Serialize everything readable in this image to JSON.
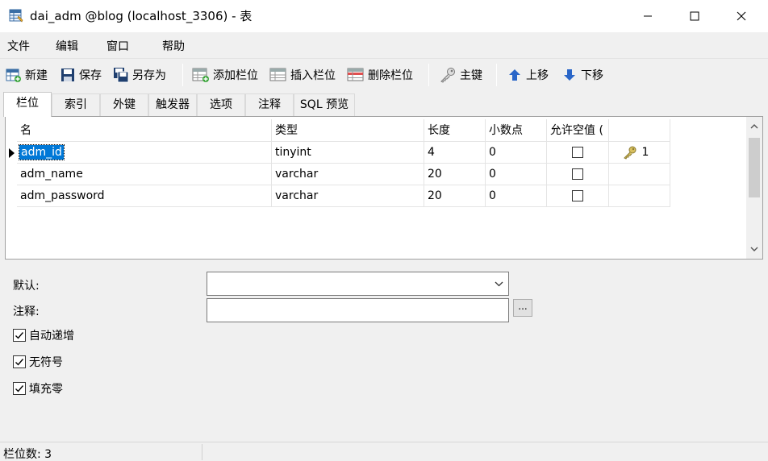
{
  "window": {
    "title": "dai_adm @blog (localhost_3306) - 表"
  },
  "menu": [
    "文件",
    "编辑",
    "窗口",
    "帮助"
  ],
  "toolbar": {
    "new": "新建",
    "save": "保存",
    "save_as": "另存为",
    "add_field": "添加栏位",
    "insert_field": "插入栏位",
    "delete_field": "删除栏位",
    "primary_key": "主键",
    "move_up": "上移",
    "move_down": "下移"
  },
  "tabs": [
    "栏位",
    "索引",
    "外键",
    "触发器",
    "选项",
    "注释",
    "SQL 预览"
  ],
  "grid": {
    "headers": [
      "名",
      "类型",
      "长度",
      "小数点",
      "允许空值 ("
    ],
    "rows": [
      {
        "name": "adm_id",
        "type": "tinyint",
        "length": "4",
        "decimals": "0",
        "allow_null": false,
        "key": "1"
      },
      {
        "name": "adm_name",
        "type": "varchar",
        "length": "20",
        "decimals": "0",
        "allow_null": false,
        "key": ""
      },
      {
        "name": "adm_password",
        "type": "varchar",
        "length": "20",
        "decimals": "0",
        "allow_null": false,
        "key": ""
      }
    ]
  },
  "properties": {
    "default_label": "默认:",
    "default_value": "",
    "comment_label": "注释:",
    "comment_value": "",
    "ellipsis": "...",
    "options": [
      {
        "label": "自动递增",
        "checked": true
      },
      {
        "label": "无符号",
        "checked": true
      },
      {
        "label": "填充零",
        "checked": true
      }
    ]
  },
  "status": {
    "field_count": "栏位数: 3"
  },
  "colors": {
    "selection": "#0078d7",
    "panel": "#f0f0f0"
  }
}
